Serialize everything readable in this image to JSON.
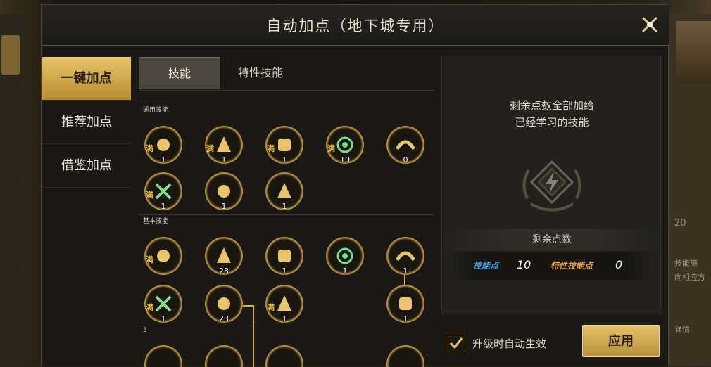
{
  "dialog": {
    "title": "自动加点（地下城专用）"
  },
  "nav": {
    "items": [
      {
        "label": "一键加点",
        "active": true
      },
      {
        "label": "推荐加点",
        "active": false
      },
      {
        "label": "借鉴加点",
        "active": false
      }
    ]
  },
  "tabs": [
    {
      "label": "技能",
      "active": true
    },
    {
      "label": "特性技能",
      "active": false
    }
  ],
  "sections": {
    "general": "通用技能",
    "basic": "基本技能",
    "third": "5"
  },
  "full_mark": "满",
  "skills_general": [
    {
      "level": "1",
      "full": true
    },
    {
      "level": "1",
      "full": true
    },
    {
      "level": "1",
      "full": true
    },
    {
      "level": "10",
      "full": true
    },
    {
      "level": "0",
      "full": false
    },
    {
      "level": "1",
      "full": true
    },
    {
      "level": "1",
      "full": false
    },
    {
      "level": "1",
      "full": false
    }
  ],
  "skills_basic": [
    {
      "level": "",
      "full": true
    },
    {
      "level": "23",
      "full": false
    },
    {
      "level": "1",
      "full": false
    },
    {
      "level": "1",
      "full": false
    },
    {
      "level": "1",
      "full": false
    },
    {
      "level": "1",
      "full": true
    },
    {
      "level": "23",
      "full": false
    },
    {
      "level": "1",
      "full": true
    },
    {
      "level": "1",
      "full": false
    }
  ],
  "panel": {
    "desc_line1": "剩余点数全部加给",
    "desc_line2": "已经学习的技能",
    "remaining_title": "剩余点数",
    "skill_points_label": "技能点",
    "skill_points_value": "10",
    "trait_points_label": "特性技能点",
    "trait_points_value": "0"
  },
  "auto_apply": {
    "label": "升级时自动生效",
    "checked": true
  },
  "apply_button": "应用",
  "background": {
    "right_text_1": "20",
    "right_text_2": "技能施",
    "right_text_3": "向相应方",
    "right_text_4": "详情"
  },
  "colors": {
    "accent_gold": "#e9c468",
    "skill_point_blue": "#3aa0e0",
    "trait_point_orange": "#e8a73a"
  }
}
